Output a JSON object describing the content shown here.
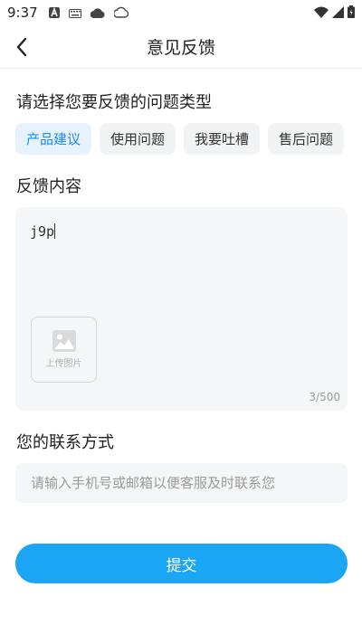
{
  "status_bar": {
    "time": "9:37",
    "left_icons": [
      "a-badge-icon",
      "keyboard-icon",
      "cloud-icon",
      "cloud-outline-icon"
    ],
    "right_icons": [
      "wifi-icon",
      "signal-icon",
      "battery-icon"
    ]
  },
  "nav": {
    "title": "意见反馈",
    "back_icon": "chevron-left-icon"
  },
  "type_section": {
    "title": "请选择您要反馈的问题类型",
    "options": [
      {
        "label": "产品建议",
        "selected": true
      },
      {
        "label": "使用问题",
        "selected": false
      },
      {
        "label": "我要吐槽",
        "selected": false
      },
      {
        "label": "售后问题",
        "selected": false
      }
    ]
  },
  "content_section": {
    "title": "反馈内容",
    "value": "j9p",
    "upload_label": "上传图片",
    "upload_icon": "image-icon",
    "counter": "3/500"
  },
  "contact_section": {
    "title": "您的联系方式",
    "placeholder": "请输入手机号或邮箱以便客服及时联系您",
    "value": ""
  },
  "submit_label": "提交",
  "colors": {
    "accent": "#1aa6f5",
    "chip_active_bg": "#e6f3ff",
    "chip_active_text": "#1a8cf0"
  }
}
